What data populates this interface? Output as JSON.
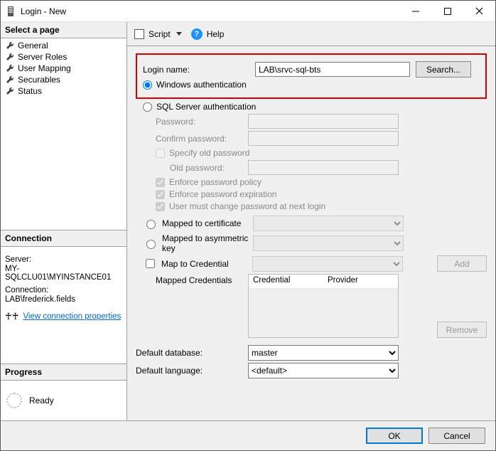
{
  "window": {
    "title": "Login - New"
  },
  "pages": {
    "header": "Select a page",
    "items": [
      "General",
      "Server Roles",
      "User Mapping",
      "Securables",
      "Status"
    ]
  },
  "connection": {
    "header": "Connection",
    "server_label": "Server:",
    "server_value": "MY-SQLCLU01\\MYINSTANCE01",
    "conn_label": "Connection:",
    "conn_value": "LAB\\frederick.fields",
    "view_props": "View connection properties"
  },
  "progress": {
    "header": "Progress",
    "status": "Ready"
  },
  "toolbar": {
    "script": "Script",
    "help": "Help"
  },
  "form": {
    "login_name_label": "Login name:",
    "login_name_value": "LAB\\srvc-sql-bts",
    "search": "Search...",
    "auth_windows": "Windows authentication",
    "auth_sql": "SQL Server authentication",
    "password_label": "Password:",
    "confirm_label": "Confirm password:",
    "specify_old": "Specify old password",
    "old_password_label": "Old password:",
    "enforce_policy": "Enforce password policy",
    "enforce_expiration": "Enforce password expiration",
    "must_change": "User must change password at next login",
    "mapped_cert": "Mapped to certificate",
    "mapped_asym": "Mapped to asymmetric key",
    "map_cred": "Map to Credential",
    "add": "Add",
    "mapped_creds_label": "Mapped Credentials",
    "grid_col1": "Credential",
    "grid_col2": "Provider",
    "remove": "Remove",
    "default_db_label": "Default database:",
    "default_db_value": "master",
    "default_lang_label": "Default language:",
    "default_lang_value": "<default>"
  },
  "footer": {
    "ok": "OK",
    "cancel": "Cancel"
  }
}
